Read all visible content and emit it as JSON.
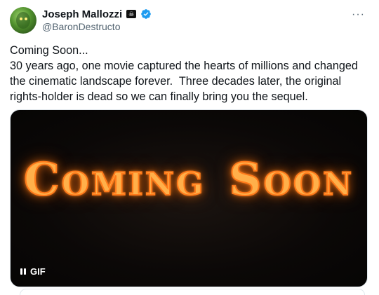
{
  "author": {
    "display_name": "Joseph Mallozzi",
    "flag_glyph": "☠",
    "handle": "@BaronDestructo",
    "verified_color": "#1d9bf0"
  },
  "more_glyph": "···",
  "tweet": {
    "text": "Coming Soon...\n30 years ago, one movie captured the hearts of millions and changed the cinematic landscape forever.  Three decades later, the original rights-holder is dead so we can finally bring you the sequel."
  },
  "media": {
    "words": [
      "Coming",
      "Soon"
    ],
    "badge_label": "GIF",
    "accent": "#ff8a24"
  }
}
